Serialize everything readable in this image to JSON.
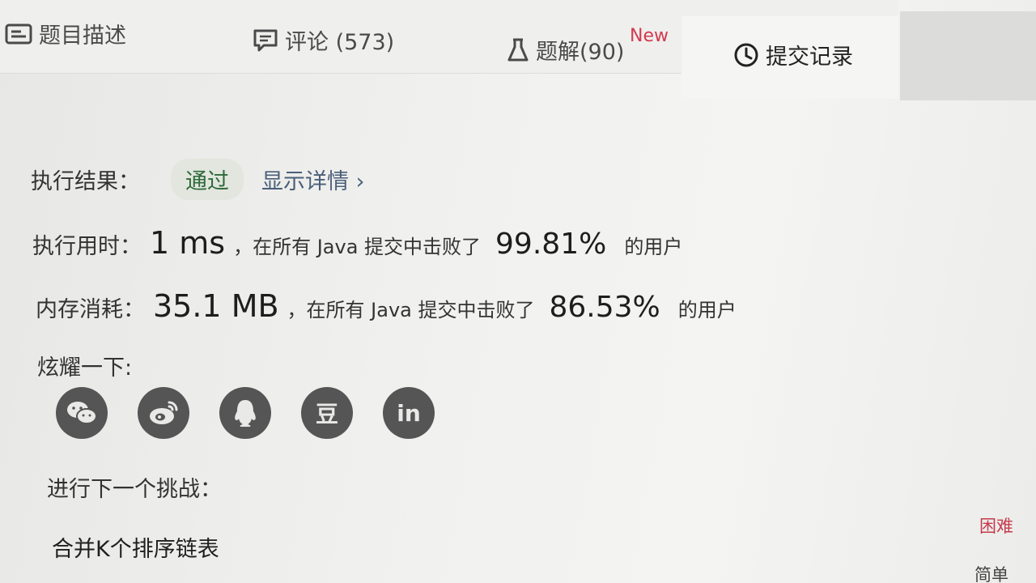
{
  "tabs": {
    "description": "题目描述",
    "comments": "评论 (573)",
    "solutions": "题解(90)",
    "solutions_badge": "New",
    "submissions": "提交记录"
  },
  "result": {
    "label": "执行结果：",
    "status": "通过",
    "details_link": "显示详情 ›"
  },
  "runtime": {
    "label": "执行用时：",
    "value": "1 ms",
    "prefix": "，在所有 Java 提交中击败了",
    "percent": "99.81%",
    "suffix": "的用户"
  },
  "memory": {
    "label": "内存消耗：",
    "value": "35.1 MB",
    "prefix": "，在所有 Java 提交中击败了",
    "percent": "86.53%",
    "suffix": "的用户"
  },
  "share": {
    "label": "炫耀一下:",
    "icons": [
      "wechat-icon",
      "weibo-icon",
      "qq-icon",
      "douban-icon",
      "linkedin-icon"
    ],
    "douban_glyph": "豆",
    "linkedin_glyph": "in"
  },
  "next": {
    "label": "进行下一个挑战：",
    "problem": "合并K个排序链表",
    "difficulty_hard": "困难",
    "difficulty_easy": "简单"
  },
  "colors": {
    "badge_new": "#d23a4f",
    "status_pass": "#2d6a3a",
    "difficulty_hard": "#c53b4d"
  }
}
